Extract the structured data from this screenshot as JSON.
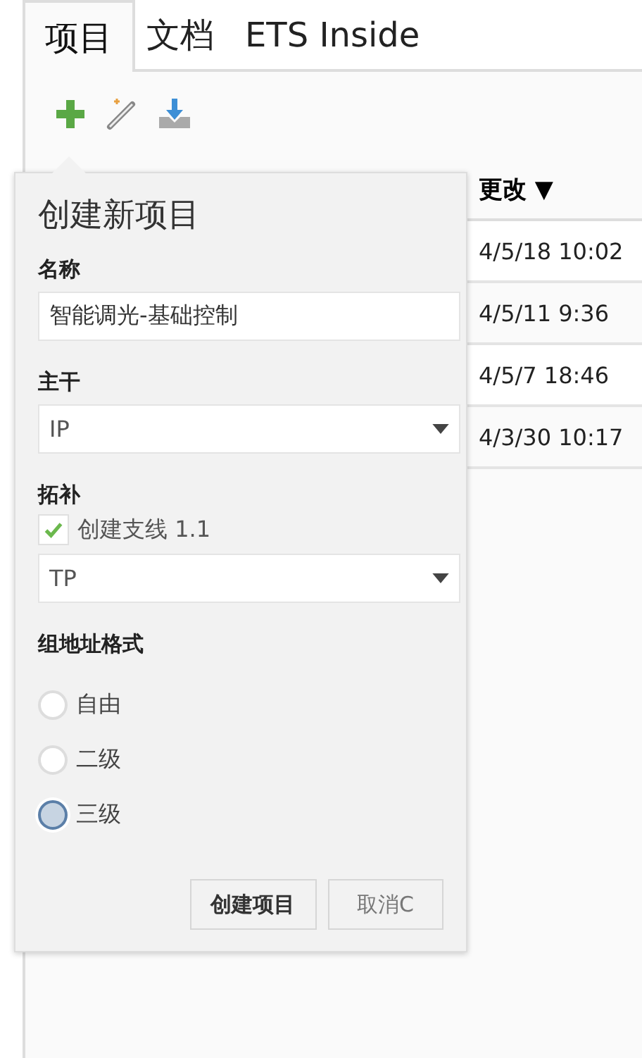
{
  "tabs": [
    {
      "label": "项目",
      "selected": true
    },
    {
      "label": "文档",
      "selected": false
    },
    {
      "label": "ETS Inside",
      "selected": false
    }
  ],
  "table": {
    "sort_column": {
      "label": "更改",
      "sort_indicator": "▼"
    },
    "rows": [
      {
        "modified": "4/5/18 10:02"
      },
      {
        "modified": "4/5/11 9:36"
      },
      {
        "modified": "4/5/7 18:46"
      },
      {
        "modified": "4/3/30 10:17"
      }
    ]
  },
  "popup": {
    "title": "创建新项目",
    "name_label": "名称",
    "name_value": "智能调光-基础控制",
    "backbone_label": "主干",
    "backbone_value": "IP",
    "topology_label": "拓补",
    "branch_checkbox": {
      "label": "创建支线 1.1",
      "checked": true
    },
    "topology_value": "TP",
    "address_label": "组地址格式",
    "address_options": [
      {
        "label": "自由",
        "selected": false
      },
      {
        "label": "二级",
        "selected": false
      },
      {
        "label": "三级",
        "selected": true
      }
    ],
    "buttons": [
      {
        "label": "创建项目",
        "kind": "primary"
      },
      {
        "label": "取消C",
        "kind": "secondary"
      }
    ]
  }
}
